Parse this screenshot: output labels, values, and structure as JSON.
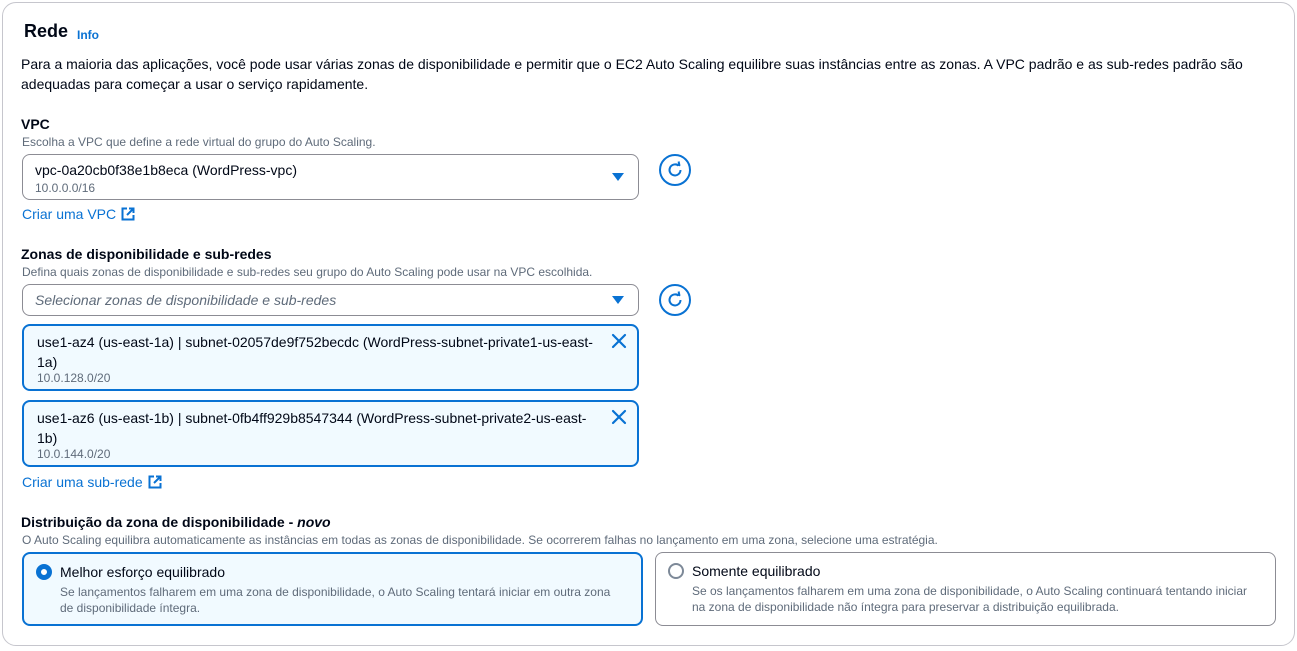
{
  "section": {
    "title": "Rede",
    "info": "Info",
    "description": "Para a maioria das aplicações, você pode usar várias zonas de disponibilidade e permitir que o EC2 Auto Scaling equilibre suas instâncias entre as zonas. A VPC padrão e as sub-redes padrão são adequadas para começar a usar o serviço rapidamente."
  },
  "vpc": {
    "label": "VPC",
    "hint": "Escolha a VPC que define a rede virtual do grupo do Auto Scaling.",
    "selected": "vpc-0a20cb0f38e1b8eca (WordPress-vpc)",
    "cidr": "10.0.0.0/16",
    "create_link": "Criar uma VPC"
  },
  "zones": {
    "label": "Zonas de disponibilidade e sub-redes",
    "hint": "Defina quais zonas de disponibilidade e sub-redes seu grupo do Auto Scaling pode usar na VPC escolhida.",
    "placeholder": "Selecionar zonas de disponibilidade e sub-redes",
    "tokens": [
      {
        "label": "use1-az4 (us-east-1a) | subnet-02057de9f752becdc (WordPress-subnet-private1-us-east-1a)",
        "cidr": "10.0.128.0/20"
      },
      {
        "label": "use1-az6 (us-east-1b) | subnet-0fb4ff929b8547344 (WordPress-subnet-private2-us-east-1b)",
        "cidr": "10.0.144.0/20"
      }
    ],
    "create_link": "Criar uma sub-rede"
  },
  "distribution": {
    "label": "Distribuição da zona de disponibilidade - ",
    "label_new": "novo",
    "hint": "O Auto Scaling equilibra automaticamente as instâncias em todas as zonas de disponibilidade. Se ocorrerem falhas no lançamento em uma zona, selecione uma estratégia.",
    "options": [
      {
        "label": "Melhor esforço equilibrado",
        "description": "Se lançamentos falharem em uma zona de disponibilidade, o Auto Scaling tentará iniciar em outra zona de disponibilidade íntegra.",
        "selected": true
      },
      {
        "label": "Somente equilibrado",
        "description": "Se os lançamentos falharem em uma zona de disponibilidade, o Auto Scaling continuará tentando iniciar na zona de disponibilidade não íntegra para preservar a distribuição equilibrada.",
        "selected": false
      }
    ]
  },
  "colors": {
    "accent": "#0972d3",
    "text": "#000716",
    "secondary_text": "#5f6b7a",
    "selected_bg": "#f1faff"
  }
}
